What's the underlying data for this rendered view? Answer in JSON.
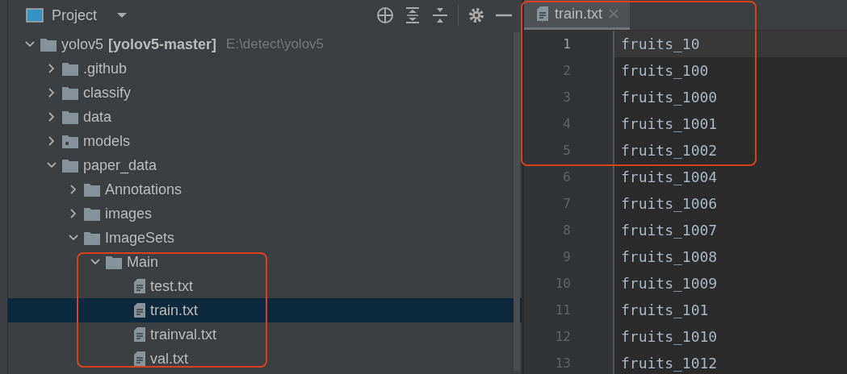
{
  "project_panel": {
    "title": "Project",
    "tree": [
      {
        "name": "yolov5",
        "module": "[yolov5-master]",
        "path": "E:\\detect\\yolov5",
        "kind": "folder",
        "expanded": true,
        "selected": false,
        "children": [
          {
            "name": ".github",
            "kind": "folder",
            "expanded": false,
            "selected": false
          },
          {
            "name": "classify",
            "kind": "folder",
            "expanded": false,
            "selected": false
          },
          {
            "name": "data",
            "kind": "folder",
            "expanded": false,
            "selected": false
          },
          {
            "name": "models",
            "kind": "package",
            "expanded": false,
            "selected": false
          },
          {
            "name": "paper_data",
            "kind": "folder",
            "expanded": true,
            "selected": false,
            "children": [
              {
                "name": "Annotations",
                "kind": "folder",
                "expanded": false,
                "selected": false
              },
              {
                "name": "images",
                "kind": "folder",
                "expanded": false,
                "selected": false
              },
              {
                "name": "ImageSets",
                "kind": "folder",
                "expanded": true,
                "selected": false,
                "children": [
                  {
                    "name": "Main",
                    "kind": "folder",
                    "expanded": true,
                    "selected": false,
                    "children": [
                      {
                        "name": "test.txt",
                        "kind": "file",
                        "selected": false
                      },
                      {
                        "name": "train.txt",
                        "kind": "file",
                        "selected": true
                      },
                      {
                        "name": "trainval.txt",
                        "kind": "file",
                        "selected": false
                      },
                      {
                        "name": "val.txt",
                        "kind": "file",
                        "selected": false
                      }
                    ]
                  }
                ]
              }
            ]
          }
        ]
      }
    ]
  },
  "editor": {
    "tabs": [
      {
        "label": "train.txt",
        "selected": true
      }
    ],
    "lines": [
      {
        "number": "1",
        "text": "fruits_10",
        "current": true
      },
      {
        "number": "2",
        "text": "fruits_100",
        "current": false
      },
      {
        "number": "3",
        "text": "fruits_1000",
        "current": false
      },
      {
        "number": "4",
        "text": "fruits_1001",
        "current": false
      },
      {
        "number": "5",
        "text": "fruits_1002",
        "current": false
      },
      {
        "number": "6",
        "text": "fruits_1004",
        "current": false
      },
      {
        "number": "7",
        "text": "fruits_1006",
        "current": false
      },
      {
        "number": "8",
        "text": "fruits_1007",
        "current": false
      },
      {
        "number": "9",
        "text": "fruits_1008",
        "current": false
      },
      {
        "number": "10",
        "text": "fruits_1009",
        "current": false
      },
      {
        "number": "11",
        "text": "fruits_101",
        "current": false
      },
      {
        "number": "12",
        "text": "fruits_1010",
        "current": false
      },
      {
        "number": "13",
        "text": "fruits_1012",
        "current": false
      }
    ]
  }
}
